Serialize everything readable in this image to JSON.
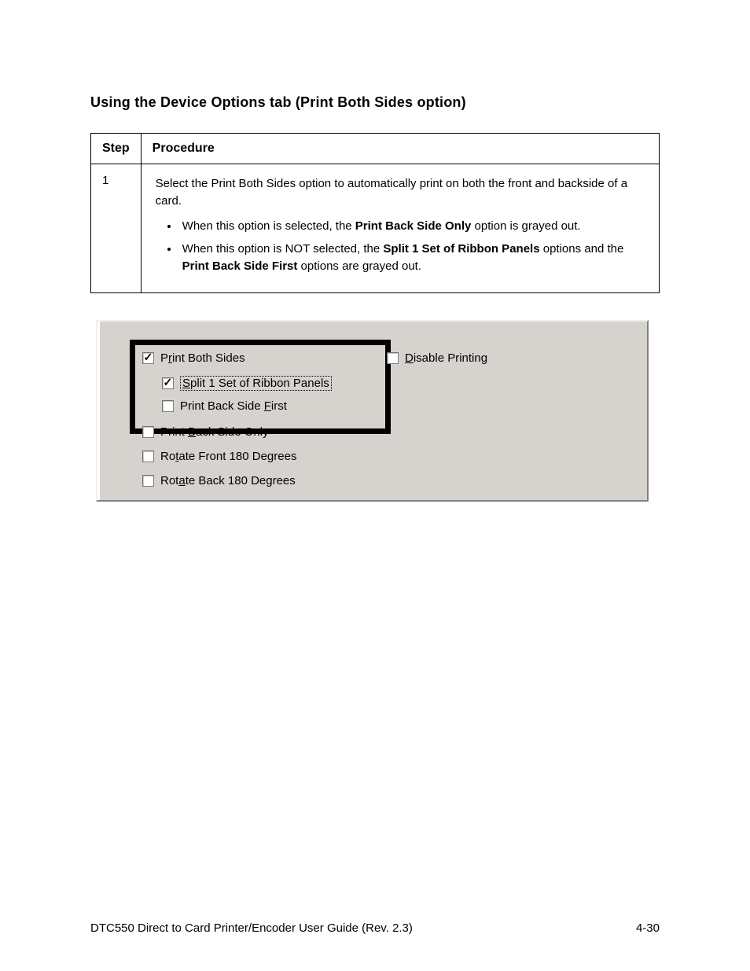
{
  "page": {
    "section_title": "Using the Device Options tab (Print Both Sides option)",
    "footer_left": "DTC550 Direct to Card Printer/Encoder User Guide (Rev. 2.3)",
    "footer_right": "4-30"
  },
  "table": {
    "head": {
      "step": "Step",
      "procedure": "Procedure"
    },
    "row": {
      "step": "1",
      "lead": "Select the Print Both Sides option to automatically print on both the front and backside of a card.",
      "bullets": [
        {
          "prefix": "When this option is selected, the ",
          "bold": "Print Back Side Only",
          "suffix": " option is grayed out."
        },
        {
          "prefix": "When this option is NOT selected, the ",
          "bold": "Split 1 Set of Ribbon Panels",
          "mid": " options and the ",
          "bold2": "Print Back Side First",
          "suffix": " options are grayed out."
        }
      ]
    }
  },
  "checkboxes": {
    "printBothSides": {
      "label_pre": "P",
      "u": "r",
      "label_post": "int Both Sides",
      "checked": true
    },
    "splitRibbon": {
      "u": "S",
      "label_post": "plit 1 Set of Ribbon Panels",
      "checked": true
    },
    "printBackFirst": {
      "label_pre": "Print Back Side ",
      "u": "F",
      "label_post": "irst",
      "checked": false
    },
    "printBackOnly": {
      "label_pre": "Print ",
      "u": "B",
      "label_post": "ack Side Only",
      "checked": false
    },
    "rotateFront": {
      "label_pre": "Ro",
      "u": "t",
      "label_post": "ate Front 180 Degrees",
      "checked": false
    },
    "rotateBack": {
      "u_pre": "Rot",
      "u": "a",
      "label_post": "te Back 180 Degrees",
      "checked": false
    },
    "disablePrinting": {
      "u": "D",
      "label_post": "isable Printing",
      "checked": false
    }
  }
}
